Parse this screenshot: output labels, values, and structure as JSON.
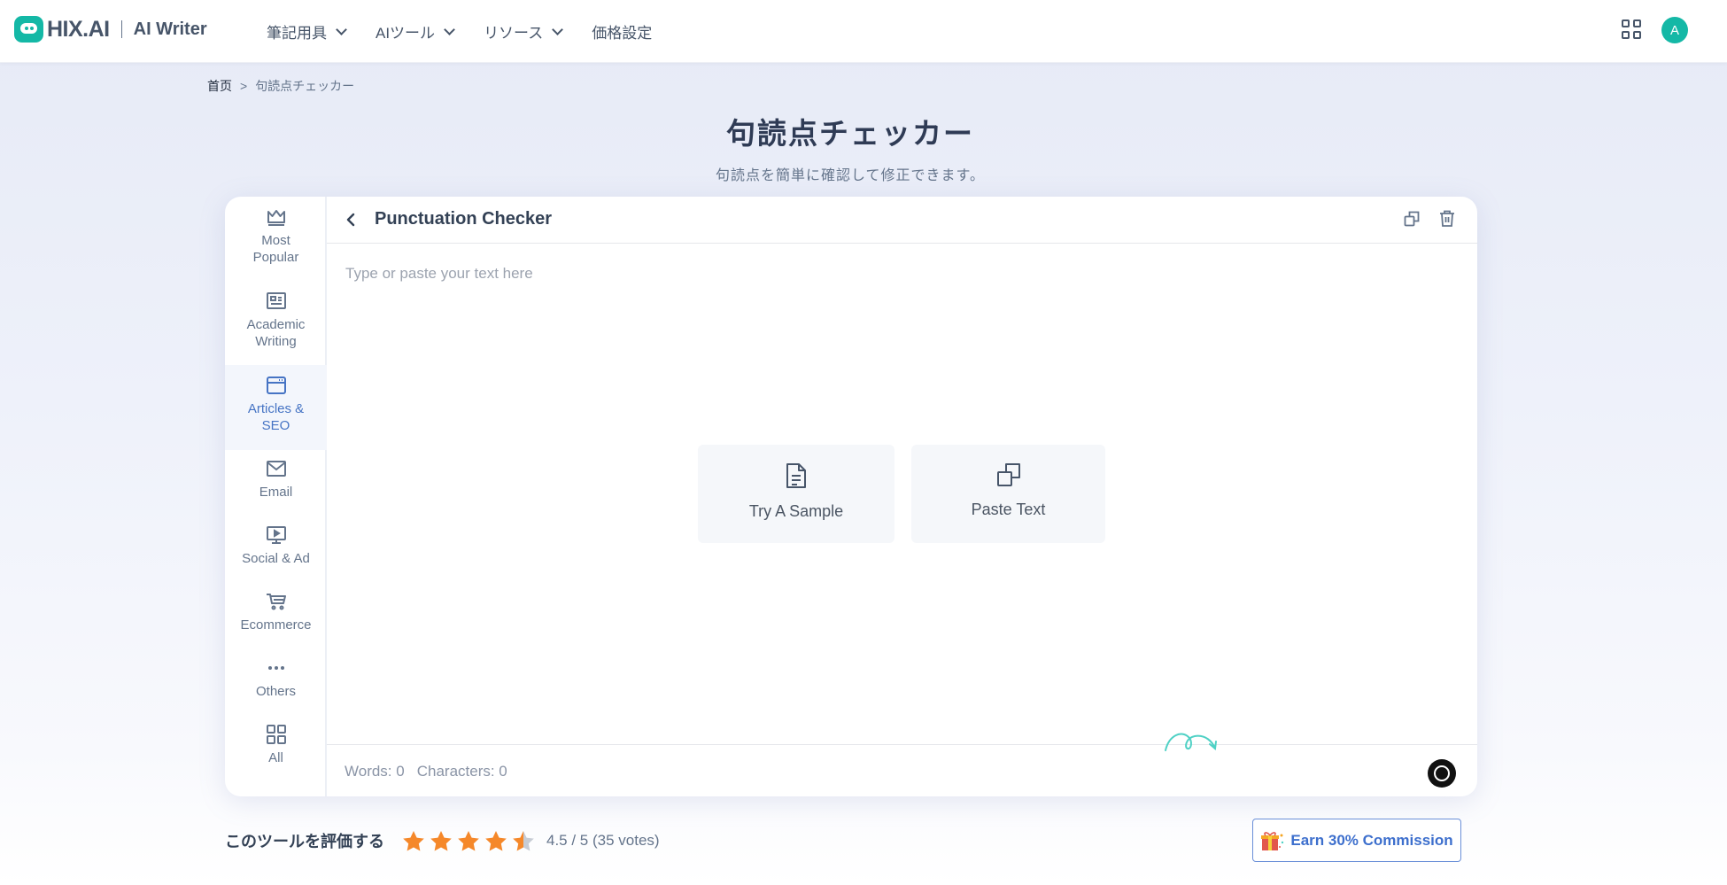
{
  "header": {
    "logo_text": "HIX.AI",
    "product": "AI Writer",
    "nav": [
      {
        "label": "筆記用具",
        "dropdown": true
      },
      {
        "label": "AIツール",
        "dropdown": true
      },
      {
        "label": "リソース",
        "dropdown": true
      },
      {
        "label": "価格設定",
        "dropdown": false
      }
    ],
    "avatar_initial": "A"
  },
  "breadcrumb": {
    "home": "首页",
    "separator": ">",
    "current": "句読点チェッカー"
  },
  "page": {
    "title": "句読点チェッカー",
    "subtitle": "句読点を簡単に確認して修正できます。"
  },
  "sidebar": {
    "items": [
      {
        "label": "Most Popular",
        "icon": "crown-icon",
        "active": false
      },
      {
        "label": "Academic Writing",
        "icon": "newspaper-icon",
        "active": false
      },
      {
        "label": "Articles & SEO",
        "icon": "browser-window-icon",
        "active": true
      },
      {
        "label": "Email",
        "icon": "envelope-icon",
        "active": false
      },
      {
        "label": "Social & Ad",
        "icon": "monitor-play-icon",
        "active": false
      },
      {
        "label": "Ecommerce",
        "icon": "cart-icon",
        "active": false
      },
      {
        "label": "Others",
        "icon": "more-dots-icon",
        "active": false
      },
      {
        "label": "All",
        "icon": "grid-icon",
        "active": false
      }
    ]
  },
  "editor": {
    "title": "Punctuation Checker",
    "placeholder": "Type or paste your text here",
    "actions": {
      "sample": "Try A Sample",
      "paste": "Paste Text"
    },
    "words_label": "Words: 0",
    "chars_label": "Characters: 0"
  },
  "rating": {
    "label": "このツールを評価する",
    "stars": 4.5,
    "score": "4.5 / 5 (35 votes)"
  },
  "commission": {
    "label": "Earn 30% Commission"
  },
  "colors": {
    "accent": "#14b8a6",
    "active_blue": "#4674c4",
    "star": "#f5882a"
  }
}
